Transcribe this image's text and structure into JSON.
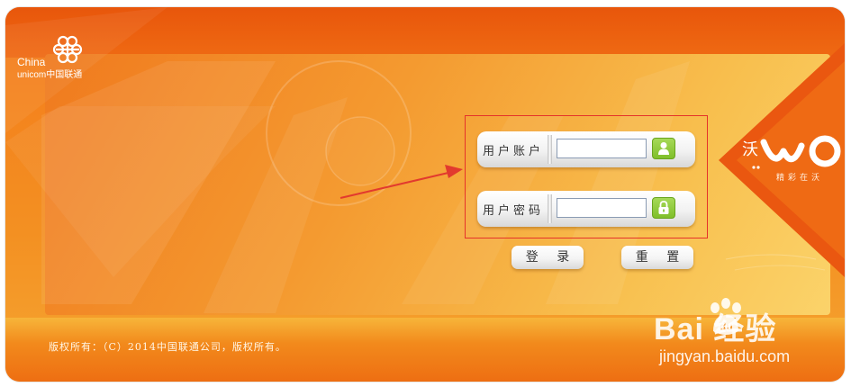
{
  "brand": {
    "logo_en_line1": "China",
    "logo_en_line2": "unicom中国联通",
    "wo_char": "沃",
    "wo_tagline": "精彩在沃"
  },
  "login": {
    "account_label": "用户账户",
    "account_value": "",
    "password_label": "用户密码",
    "password_value": "",
    "login_button": "登 录",
    "reset_button": "重 置"
  },
  "footer": {
    "copyright": "版权所有：（C）2014中国联通公司，版权所有。"
  },
  "watermark": {
    "logo_text": "Bai  经验",
    "url": "jingyan.baidu.com"
  },
  "colors": {
    "primary_orange": "#f47a1a",
    "highlight_red": "#e5332a",
    "icon_green": "#7fbf2a"
  }
}
